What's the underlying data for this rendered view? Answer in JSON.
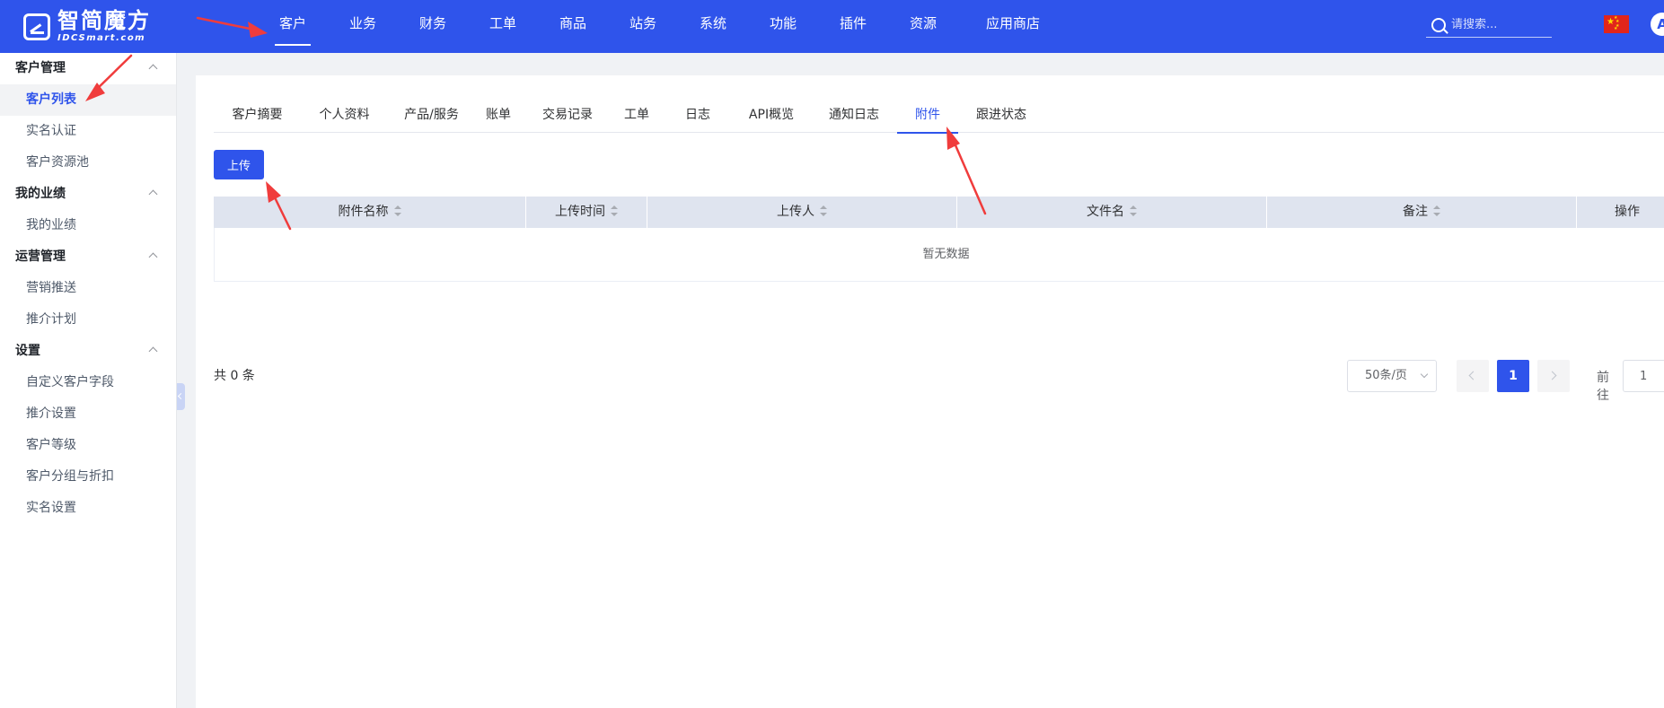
{
  "header": {
    "logo_cn": "智简魔方",
    "logo_en": "IDCSmart.com",
    "nav": [
      "客户",
      "业务",
      "财务",
      "工单",
      "商品",
      "站务",
      "系统",
      "功能",
      "插件",
      "资源",
      "应用商店"
    ],
    "search_placeholder": "请搜索...",
    "avatar_letter": "A"
  },
  "sidebar": {
    "groups": [
      {
        "title": "客户管理",
        "items": [
          "客户列表",
          "实名认证",
          "客户资源池"
        ]
      },
      {
        "title": "我的业绩",
        "items": [
          "我的业绩"
        ]
      },
      {
        "title": "运营管理",
        "items": [
          "营销推送",
          "推介计划"
        ]
      },
      {
        "title": "设置",
        "items": [
          "自定义客户字段",
          "推介设置",
          "客户等级",
          "客户分组与折扣",
          "实名设置"
        ]
      }
    ]
  },
  "tabs": [
    "客户摘要",
    "个人资料",
    "产品/服务",
    "账单",
    "交易记录",
    "工单",
    "日志",
    "API概览",
    "通知日志",
    "附件",
    "跟进状态"
  ],
  "upload_label": "上传",
  "table": {
    "columns": [
      "附件名称",
      "上传时间",
      "上传人",
      "文件名",
      "备注",
      "操作"
    ],
    "empty_text": "暂无数据"
  },
  "pagination": {
    "total_text": "共 0 条",
    "page_size": "50条/页",
    "current_page": "1",
    "goto_label": "前往",
    "goto_value": "1"
  },
  "colors": {
    "primary": "#2f54eb",
    "annotation_arrow": "#f03c3c"
  }
}
